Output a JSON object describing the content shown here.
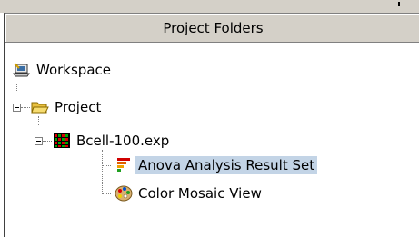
{
  "panel": {
    "title": "Project Folders"
  },
  "tree": {
    "workspace": {
      "label": "Workspace",
      "icon": "workspace-icon"
    },
    "project": {
      "label": "Project",
      "icon": "open-folder-icon",
      "expanded": true
    },
    "experiment": {
      "label": "Bcell-100.exp",
      "icon": "heatmap-grid-icon",
      "expanded": true
    },
    "children": [
      {
        "label": "Anova Analysis Result Set",
        "icon": "bar-chart-icon",
        "selected": true
      },
      {
        "label": "Color Mosaic View",
        "icon": "palette-icon",
        "selected": false
      }
    ]
  },
  "colors": {
    "header_bg": "#d4d0c8",
    "selection_bg": "#c3d4e6"
  }
}
